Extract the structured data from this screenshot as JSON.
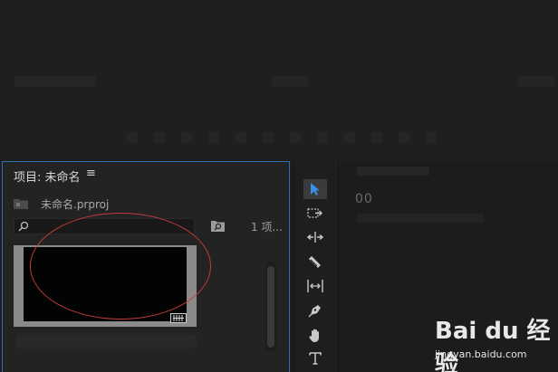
{
  "project_panel": {
    "title": "项目: 未命名",
    "menu_glyph": "≡",
    "project_file": "未命名.prproj",
    "search_placeholder": "",
    "item_count": "1 项..."
  },
  "program": {
    "timecode": "00"
  },
  "tools": [
    {
      "name": "selection-tool-icon",
      "active": true
    },
    {
      "name": "track-select-tool-icon",
      "active": false
    },
    {
      "name": "ripple-edit-tool-icon",
      "active": false
    },
    {
      "name": "razor-tool-icon",
      "active": false
    },
    {
      "name": "slip-tool-icon",
      "active": false
    },
    {
      "name": "pen-tool-icon",
      "active": false
    },
    {
      "name": "hand-tool-icon",
      "active": false
    },
    {
      "name": "type-tool-icon",
      "active": false
    }
  ],
  "watermark": {
    "logo": "Bai du 经验",
    "url": "jingyan.baidu.com"
  },
  "colors": {
    "panel_focus_border": "#2d6fb3",
    "selection_tool_blue": "#3d8ee6",
    "annotation_red": "#c23a3a"
  }
}
